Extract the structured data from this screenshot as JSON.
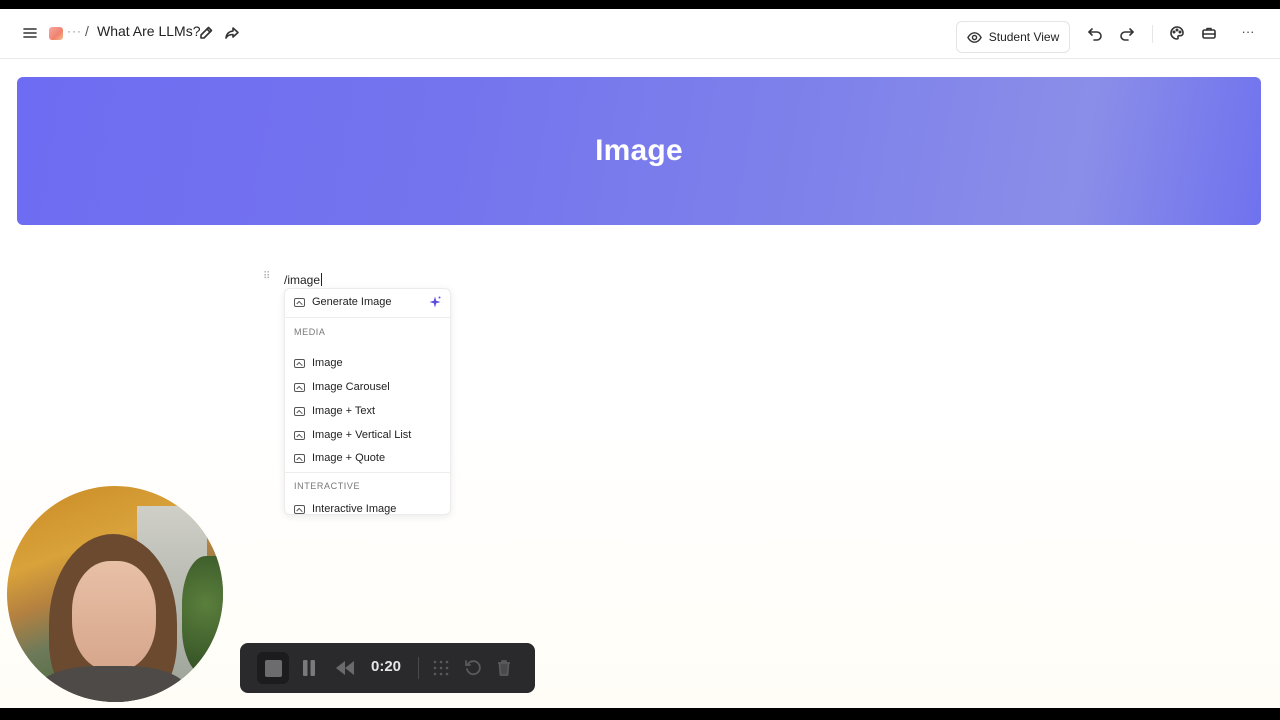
{
  "topbar": {
    "breadcrumb_ellipsis": "···",
    "breadcrumb_separator": "/",
    "doc_title": "What Are LLMs?",
    "student_view_label": "Student View",
    "more_label": "···"
  },
  "banner": {
    "title": "Image"
  },
  "editor": {
    "command_text": "/image"
  },
  "menu": {
    "top_item": "Generate Image",
    "sections": [
      {
        "label": "MEDIA",
        "items": [
          "Image",
          "Image Carousel",
          "Image + Text",
          "Image + Vertical List",
          "Image + Quote"
        ]
      },
      {
        "label": "INTERACTIVE",
        "items": [
          "Interactive Image"
        ]
      }
    ]
  },
  "recorder": {
    "time": "0:20"
  },
  "colors": {
    "banner_start": "#6e6cf2",
    "banner_end": "#8b8ee8",
    "sparkle": "#5b4de0",
    "recorder_bg": "#2a2a2c"
  }
}
